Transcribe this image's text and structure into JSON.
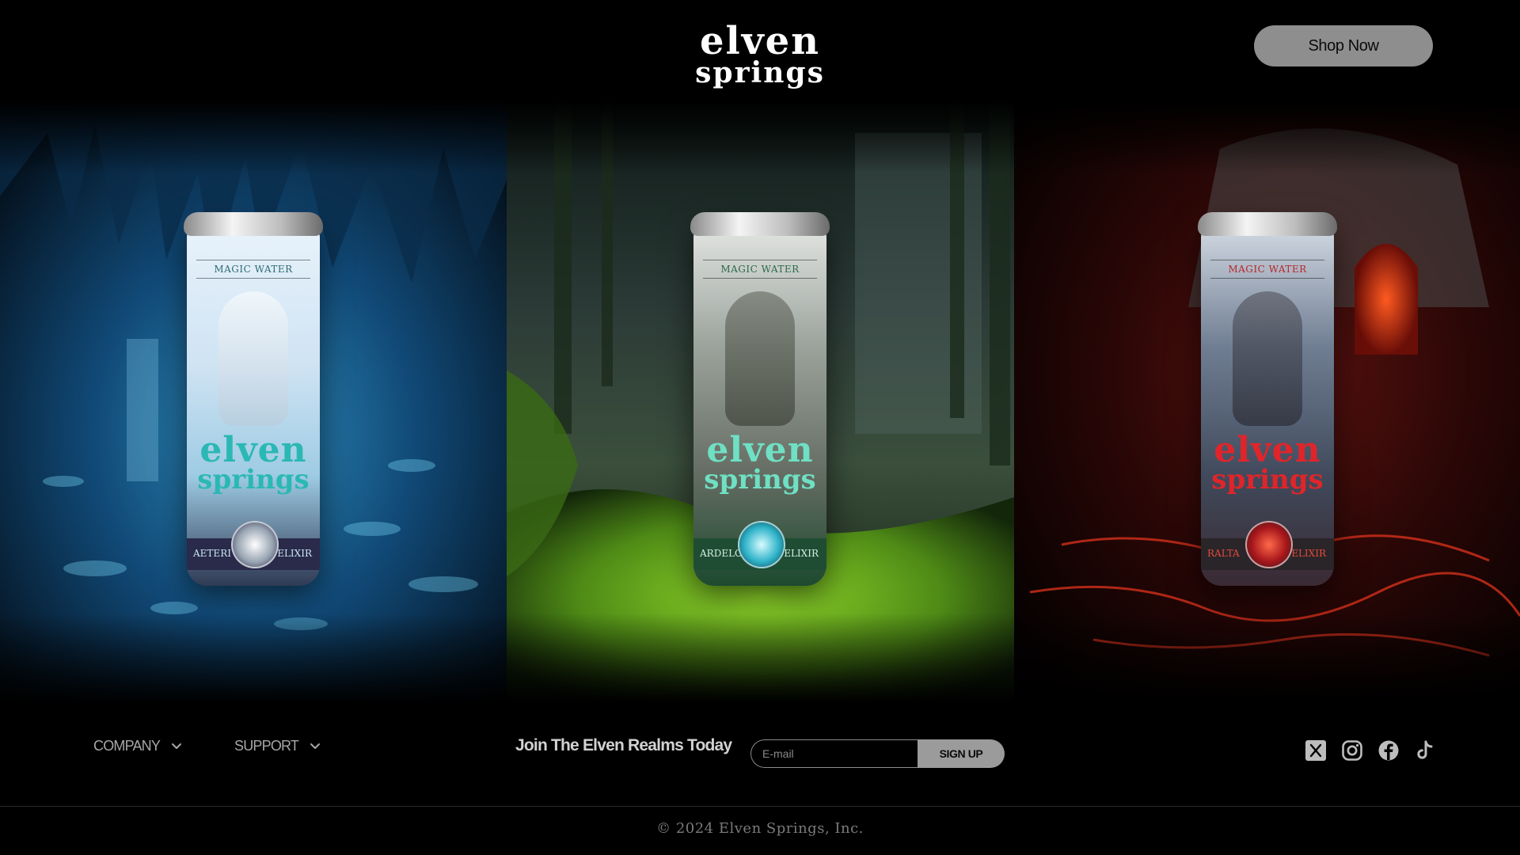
{
  "header": {
    "logo_line1": "Elven",
    "logo_line2": "Springs",
    "shop_label": "Shop Now"
  },
  "products": [
    {
      "tag": "Magic Water",
      "brand_line1": "Elven",
      "brand_line2": "Springs",
      "band_name": "Aeteri",
      "band_type": "Elixir",
      "theme": "ice-cave",
      "accent": "#2bb8b4"
    },
    {
      "tag": "Magic Water",
      "brand_line1": "Elven",
      "brand_line2": "Springs",
      "band_name": "Ardelorc",
      "band_type": "Elixir",
      "theme": "moss-forest",
      "accent": "#6fe0c4"
    },
    {
      "tag": "Magic Water",
      "brand_line1": "Elven",
      "brand_line2": "Springs",
      "band_name": "Ralta",
      "band_type": "Elixir",
      "theme": "lava-cavern",
      "accent": "#e0252a"
    }
  ],
  "footer": {
    "nav": [
      {
        "label": "COMPANY",
        "icon": "chevron-down-icon"
      },
      {
        "label": "SUPPORT",
        "icon": "chevron-down-icon"
      }
    ],
    "join_text": "Join The Elven Realms Today",
    "email_placeholder": "E-mail",
    "signup_label": "SIGN UP",
    "socials": [
      "x-icon",
      "instagram-icon",
      "facebook-icon",
      "tiktok-icon"
    ],
    "copyright": "© 2024 Elven Springs, Inc."
  }
}
